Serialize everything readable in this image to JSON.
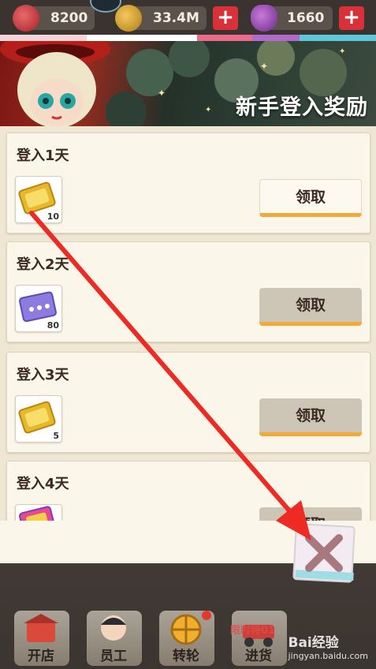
{
  "resources": {
    "hearts": "8200",
    "coins": "33.4M",
    "potions": "1660"
  },
  "popup": {
    "title": "新手登入奖励",
    "days": [
      {
        "label": "登入1天",
        "qty": "10",
        "item_icon": "gold-ticket-icon",
        "claim": "领取",
        "state": "active"
      },
      {
        "label": "登入2天",
        "qty": "80",
        "item_icon": "purple-ticket-icon",
        "claim": "领取",
        "state": "disabled"
      },
      {
        "label": "登入3天",
        "qty": "5",
        "item_icon": "gold-ticket-icon",
        "claim": "领取",
        "state": "disabled"
      },
      {
        "label": "登入4天",
        "qty": "",
        "item_icon": "colorful-ticket-icon",
        "claim": "领取",
        "state": "disabled"
      }
    ]
  },
  "bottom_nav": [
    {
      "label": "开店",
      "icon": "shop-icon"
    },
    {
      "label": "员工",
      "icon": "staff-icon"
    },
    {
      "label": "转轮",
      "icon": "wheel-icon"
    },
    {
      "label": "进货",
      "icon": "delivery-icon"
    }
  ],
  "promo_text": "限时特01",
  "watermark": {
    "main": "Bai经验",
    "sub": "jingyan.baidu.com"
  },
  "colors": {
    "accent_red": "#d8313a",
    "claim_underline": "#f1a93a",
    "annotation_arrow": "#ee2a24"
  }
}
